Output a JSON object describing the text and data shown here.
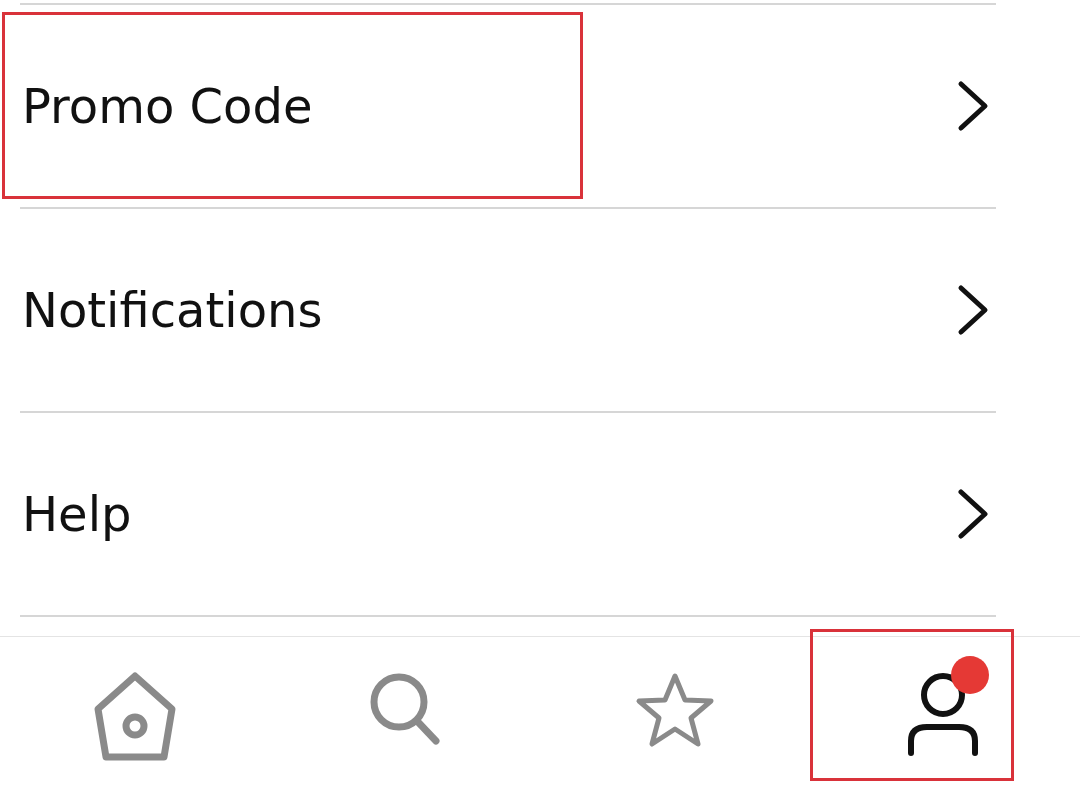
{
  "menu_items": [
    {
      "label": "Promo Code",
      "highlighted": true
    },
    {
      "label": "Notifications",
      "highlighted": false
    },
    {
      "label": "Help",
      "highlighted": false
    }
  ],
  "tab_bar": [
    {
      "kind": "home",
      "selected": false,
      "badge": false,
      "highlighted": false
    },
    {
      "kind": "search",
      "selected": false,
      "badge": false,
      "highlighted": false
    },
    {
      "kind": "favorites",
      "selected": false,
      "badge": false,
      "highlighted": false
    },
    {
      "kind": "profile",
      "selected": true,
      "badge": true,
      "highlighted": true
    }
  ]
}
